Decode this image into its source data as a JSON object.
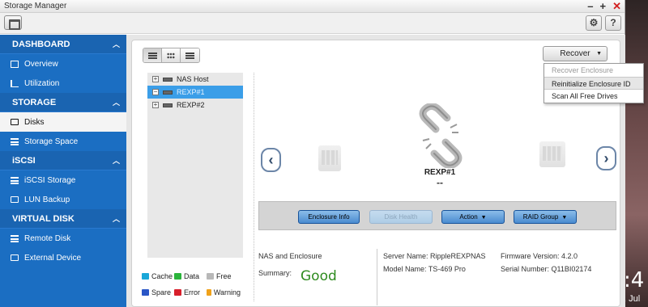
{
  "window": {
    "title": "Storage Manager"
  },
  "toolbar": {
    "settings_icon": "gear-icon",
    "help_label": "?"
  },
  "sidebar": {
    "sections": [
      {
        "label": "DASHBOARD",
        "items": [
          {
            "label": "Overview",
            "icon": "grid-icon"
          },
          {
            "label": "Utilization",
            "icon": "chart-icon"
          }
        ]
      },
      {
        "label": "STORAGE",
        "items": [
          {
            "label": "Disks",
            "icon": "disk-icon",
            "active": true
          },
          {
            "label": "Storage Space",
            "icon": "stack-icon"
          }
        ]
      },
      {
        "label": "iSCSI",
        "items": [
          {
            "label": "iSCSI Storage",
            "icon": "stack-icon"
          },
          {
            "label": "LUN Backup",
            "icon": "disk-icon"
          }
        ]
      },
      {
        "label": "VIRTUAL DISK",
        "items": [
          {
            "label": "Remote Disk",
            "icon": "stack-icon"
          },
          {
            "label": "External Device",
            "icon": "disk-icon"
          }
        ]
      }
    ]
  },
  "recover": {
    "label": "Recover",
    "menu": [
      {
        "label": "Recover Enclosure",
        "disabled": true
      },
      {
        "label": "Reinitialize Enclosure ID",
        "hover": true
      },
      {
        "label": "Scan All Free Drives"
      }
    ]
  },
  "tree": [
    {
      "label": "NAS Host",
      "expander": "+"
    },
    {
      "label": "REXP#1",
      "expander": "−",
      "selected": true
    },
    {
      "label": "REXP#2",
      "expander": "+"
    }
  ],
  "enclosure": {
    "name": "REXP#1",
    "status": "--"
  },
  "actions": {
    "enclosure_info": "Enclosure Info",
    "disk_health": "Disk Health",
    "action": "Action",
    "raid_group": "RAID Group"
  },
  "legend": [
    {
      "label": "Cache",
      "color": "#1aa7d8"
    },
    {
      "label": "Data",
      "color": "#2bb43b"
    },
    {
      "label": "Free",
      "color": "#b8b8b8"
    },
    {
      "label": "Spare",
      "color": "#2a56c6"
    },
    {
      "label": "Error",
      "color": "#d81f2b"
    },
    {
      "label": "Warning",
      "color": "#f0a21a"
    }
  ],
  "info": {
    "nas_and_enclosure": "NAS and Enclosure",
    "summary_label": "Summary:",
    "summary_value": "Good",
    "server_name": "Server Name: RippleREXPNAS",
    "model_name": "Model Name: TS-469 Pro",
    "firmware": "Firmware Version: 4.2.0",
    "serial": "Serial Number: Q11BI02174"
  },
  "desktop": {
    "clock": ":4",
    "date": ", Jul"
  }
}
